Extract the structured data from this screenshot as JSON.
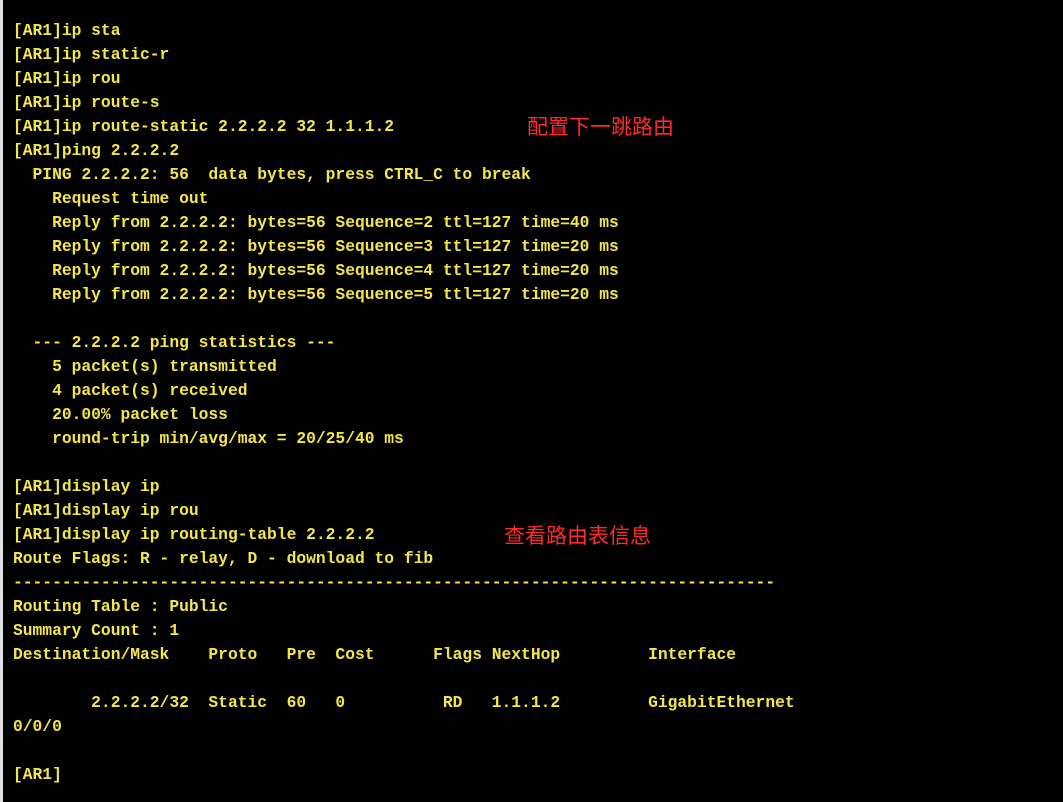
{
  "terminal": {
    "lines": [
      "[AR1]ip sta",
      "[AR1]ip static-r",
      "[AR1]ip rou",
      "[AR1]ip route-s",
      "[AR1]ip route-static 2.2.2.2 32 1.1.1.2",
      "[AR1]ping 2.2.2.2",
      "  PING 2.2.2.2: 56  data bytes, press CTRL_C to break",
      "    Request time out",
      "    Reply from 2.2.2.2: bytes=56 Sequence=2 ttl=127 time=40 ms",
      "    Reply from 2.2.2.2: bytes=56 Sequence=3 ttl=127 time=20 ms",
      "    Reply from 2.2.2.2: bytes=56 Sequence=4 ttl=127 time=20 ms",
      "    Reply from 2.2.2.2: bytes=56 Sequence=5 ttl=127 time=20 ms",
      "",
      "  --- 2.2.2.2 ping statistics ---",
      "    5 packet(s) transmitted",
      "    4 packet(s) received",
      "    20.00% packet loss",
      "    round-trip min/avg/max = 20/25/40 ms",
      "",
      "[AR1]display ip",
      "[AR1]display ip rou",
      "[AR1]display ip routing-table 2.2.2.2",
      "Route Flags: R - relay, D - download to fib",
      "------------------------------------------------------------------------------",
      "Routing Table : Public",
      "Summary Count : 1",
      "Destination/Mask    Proto   Pre  Cost      Flags NextHop         Interface",
      "",
      "        2.2.2.2/32  Static  60   0          RD   1.1.1.2         GigabitEthernet",
      "0/0/0",
      "",
      "[AR1]"
    ]
  },
  "annotations": {
    "static_route_note": "配置下一跳路由",
    "routing_table_note": "查看路由表信息"
  },
  "colors": {
    "background": "#000000",
    "terminal_text": "#f2e64b",
    "annotation_text": "#ff2a2a"
  }
}
